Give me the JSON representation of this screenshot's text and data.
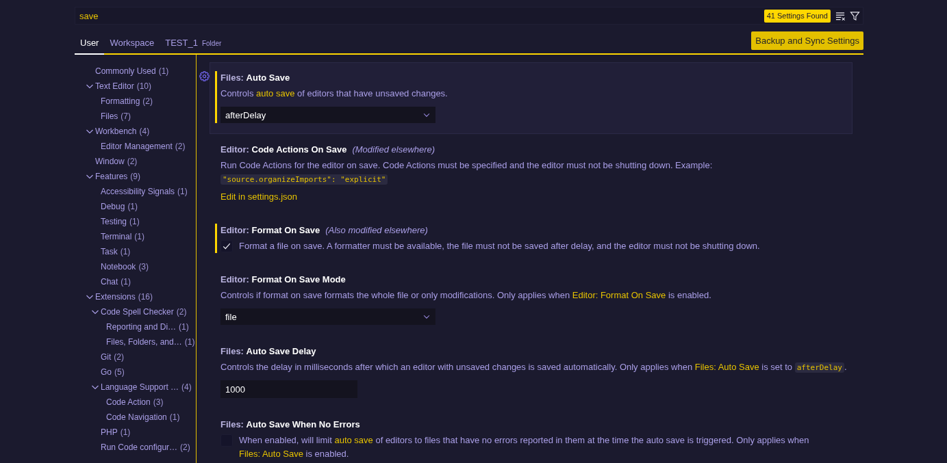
{
  "search": {
    "value": "save",
    "result_count": "41 Settings Found"
  },
  "tabs": [
    {
      "label": "User",
      "selected": true
    },
    {
      "label": "Workspace",
      "selected": false
    },
    {
      "label": "TEST_1",
      "sublabel": "Folder",
      "selected": false
    }
  ],
  "sync_button": "Backup and Sync Settings",
  "toc": [
    {
      "label": "Commonly Used",
      "count": "(1)"
    },
    {
      "label": "Text Editor",
      "count": "(10)",
      "expanded": true,
      "children": [
        {
          "label": "Formatting",
          "count": "(2)"
        },
        {
          "label": "Files",
          "count": "(7)"
        }
      ]
    },
    {
      "label": "Workbench",
      "count": "(4)",
      "expanded": true,
      "children": [
        {
          "label": "Editor Management",
          "count": "(2)"
        }
      ]
    },
    {
      "label": "Window",
      "count": "(2)"
    },
    {
      "label": "Features",
      "count": "(9)",
      "expanded": true,
      "children": [
        {
          "label": "Accessibility Signals",
          "count": "(1)"
        },
        {
          "label": "Debug",
          "count": "(1)"
        },
        {
          "label": "Testing",
          "count": "(1)"
        },
        {
          "label": "Terminal",
          "count": "(1)"
        },
        {
          "label": "Task",
          "count": "(1)"
        },
        {
          "label": "Notebook",
          "count": "(3)"
        },
        {
          "label": "Chat",
          "count": "(1)"
        }
      ]
    },
    {
      "label": "Extensions",
      "count": "(16)",
      "expanded": true,
      "children": [
        {
          "label": "Code Spell Checker",
          "count": "(2)",
          "expanded": true,
          "children": [
            {
              "label": "Reporting and Di…",
              "count": "(1)"
            },
            {
              "label": "Files, Folders, and…",
              "count": "(1)"
            }
          ]
        },
        {
          "label": "Git",
          "count": "(2)"
        },
        {
          "label": "Go",
          "count": "(5)"
        },
        {
          "label": "Language Support …",
          "count": "(4)",
          "expanded": true,
          "children": [
            {
              "label": "Code Action",
              "count": "(3)"
            },
            {
              "label": "Code Navigation",
              "count": "(1)"
            }
          ]
        },
        {
          "label": "PHP",
          "count": "(1)"
        },
        {
          "label": "Run Code configur…",
          "count": "(2)"
        }
      ]
    }
  ],
  "settings": [
    {
      "category": "Files:",
      "title": "Auto Save",
      "selected": true,
      "modified": true,
      "description": [
        {
          "kind": "text",
          "text": "Controls "
        },
        {
          "kind": "link",
          "text": "auto save"
        },
        {
          "kind": "text",
          "text": " of editors that have unsaved changes."
        }
      ],
      "control": {
        "kind": "dropdown",
        "value": "afterDelay"
      }
    },
    {
      "category": "Editor:",
      "title": "Code Actions On Save",
      "note": "(Modified elsewhere)",
      "selected": false,
      "modified": false,
      "description": [
        {
          "kind": "text",
          "text": "Run Code Actions for the editor on save. Code Actions must be specified and the editor must not be shutting down. Example: "
        },
        {
          "kind": "code",
          "text": "\"source.organizeImports\": \"explicit\""
        }
      ],
      "control": {
        "kind": "link",
        "label": "Edit in settings.json"
      }
    },
    {
      "category": "Editor:",
      "title": "Format On Save",
      "note": "(Also modified elsewhere)",
      "selected": false,
      "modified": true,
      "description": [
        {
          "kind": "text",
          "text": "Format a file on save. A formatter must be available, the file must not be saved after delay, and the editor must not be shutting down."
        }
      ],
      "control": {
        "kind": "checkbox",
        "checked": true
      }
    },
    {
      "category": "Editor:",
      "title": "Format On Save Mode",
      "selected": false,
      "modified": false,
      "description": [
        {
          "kind": "text",
          "text": "Controls if format on save formats the whole file or only modifications. Only applies when "
        },
        {
          "kind": "link",
          "text": "Editor: Format On Save"
        },
        {
          "kind": "text",
          "text": " is enabled."
        }
      ],
      "control": {
        "kind": "dropdown",
        "value": "file"
      }
    },
    {
      "category": "Files:",
      "title": "Auto Save Delay",
      "selected": false,
      "modified": false,
      "description": [
        {
          "kind": "text",
          "text": "Controls the delay in milliseconds after which an editor with unsaved changes is saved automatically. Only applies when "
        },
        {
          "kind": "link",
          "text": "Files: Auto Save"
        },
        {
          "kind": "text",
          "text": " is set to "
        },
        {
          "kind": "code",
          "text": "afterDelay"
        },
        {
          "kind": "text",
          "text": "."
        }
      ],
      "control": {
        "kind": "text",
        "value": "1000"
      }
    },
    {
      "category": "Files:",
      "title": "Auto Save When No Errors",
      "selected": false,
      "modified": false,
      "description": [
        {
          "kind": "text",
          "text": "When enabled, will limit "
        },
        {
          "kind": "link",
          "text": "auto save"
        },
        {
          "kind": "text",
          "text": " of editors to files that have no errors reported in them at the time the auto save is triggered. Only applies when "
        },
        {
          "kind": "link",
          "text": "Files: Auto Save"
        },
        {
          "kind": "text",
          "text": " is enabled."
        }
      ],
      "control": {
        "kind": "checkbox",
        "checked": false
      }
    }
  ]
}
